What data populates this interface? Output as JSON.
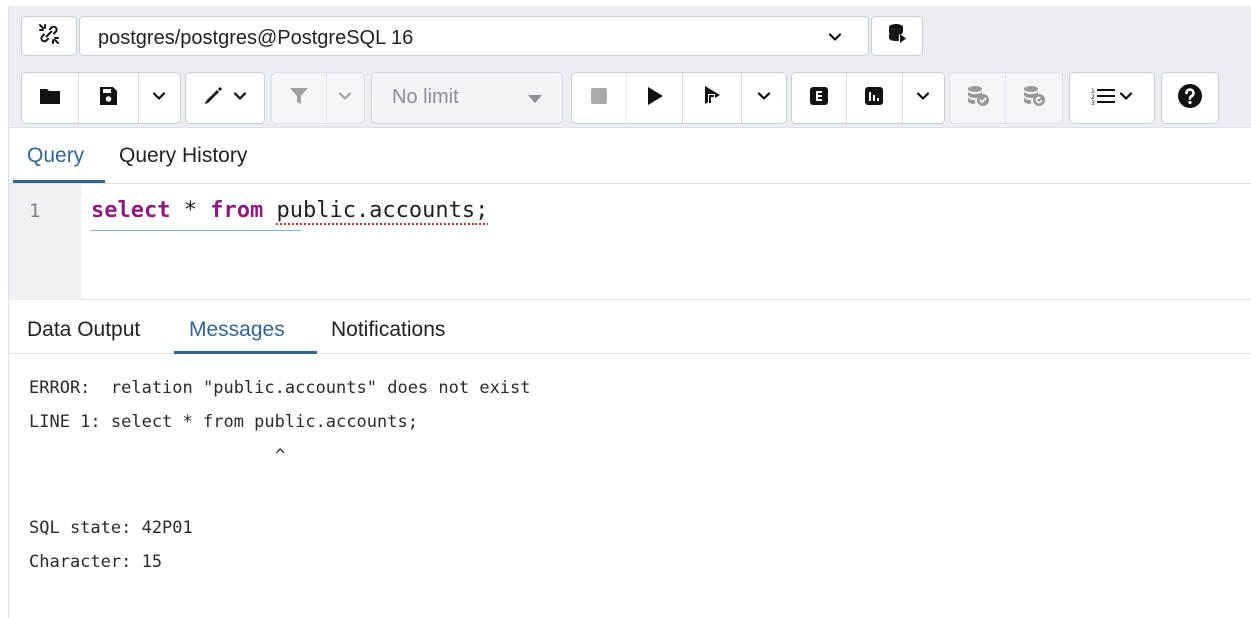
{
  "connection": {
    "label": "postgres/postgres@PostgreSQL 16"
  },
  "toolbar": {
    "icons": [
      "folder-icon",
      "save-icon",
      "chevron-down-icon",
      "pencil-icon",
      "chevron-down-icon",
      "filter-icon",
      "chevron-down-icon",
      "stop-icon",
      "play-icon",
      "execute-script-icon",
      "chevron-down-icon",
      "explain-icon",
      "explain-analyze-icon",
      "chevron-down-icon",
      "commit-icon",
      "rollback-icon",
      "macros-icon",
      "chevron-down-icon",
      "help-icon"
    ],
    "limit_value": "No limit"
  },
  "query_tabs": {
    "active": "Query",
    "items": [
      "Query",
      "Query History"
    ]
  },
  "editor": {
    "line_number": "1",
    "tokens": {
      "kw1": "select",
      "op": " * ",
      "kw2": "from",
      "space": " ",
      "ident": "public.accounts",
      "semi": ";"
    }
  },
  "output_tabs": {
    "active": "Messages",
    "items": [
      "Data Output",
      "Messages",
      "Notifications"
    ]
  },
  "messages": {
    "line1": "ERROR:  relation \"public.accounts\" does not exist",
    "line2": "LINE 1: select * from public.accounts;",
    "line3": "                      ^",
    "line4": "SQL state: 42P01",
    "line5": "Character: 15"
  },
  "colors": {
    "accent": "#326690",
    "keyword": "#8e1c7d",
    "toolbar_bg": "#ebeef3"
  }
}
